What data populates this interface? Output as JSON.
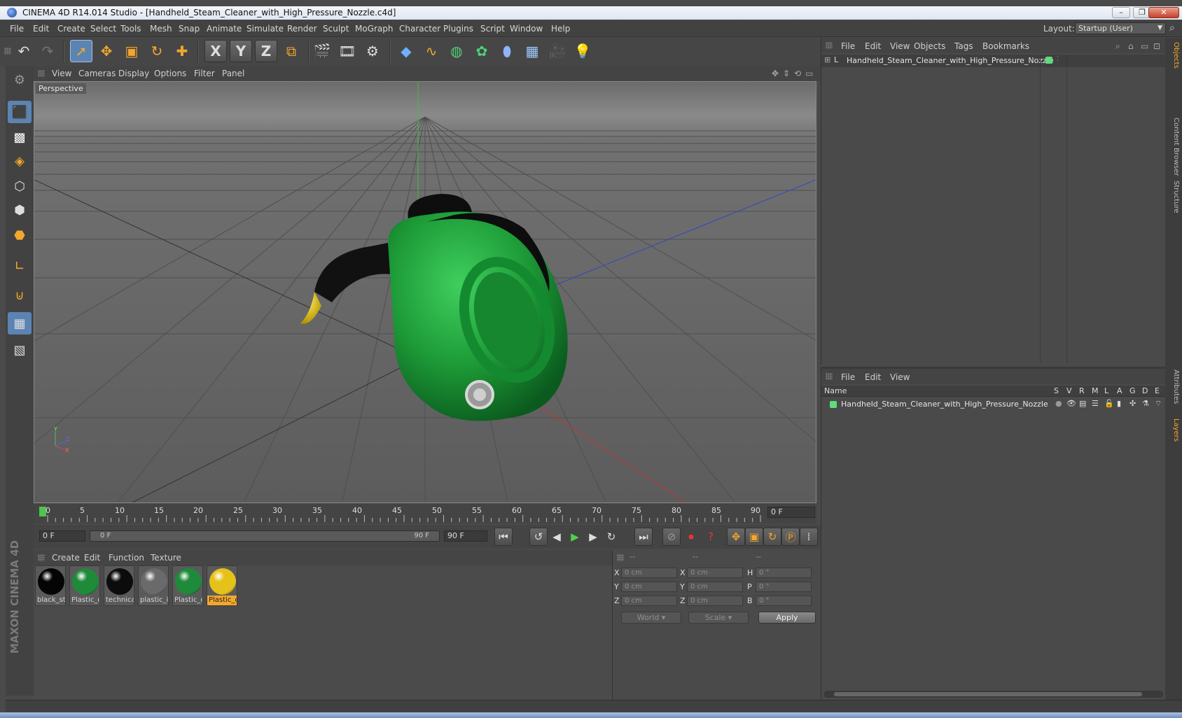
{
  "window": {
    "title": "CINEMA 4D R14.014 Studio - [Handheld_Steam_Cleaner_with_High_Pressure_Nozzle.c4d]",
    "controls": [
      "–",
      "❐",
      "✕"
    ]
  },
  "menubar": {
    "items": [
      "File",
      "Edit",
      "Create",
      "Select",
      "Tools",
      "Mesh",
      "Snap",
      "Animate",
      "Simulate",
      "Render",
      "Sculpt",
      "MoGraph",
      "Character",
      "Plugins",
      "Script",
      "Window",
      "Help"
    ],
    "layout_label": "Layout:",
    "layout_value": "Startup (User)"
  },
  "toolbar": {
    "icons": [
      "undo-icon",
      "redo-icon",
      "select-icon",
      "move-icon",
      "scale-icon",
      "rotate-icon",
      "add-icon",
      "x-axis-icon",
      "y-axis-icon",
      "z-axis-icon",
      "coordinate-system-icon",
      "render-view-icon",
      "render-picture-viewer-icon",
      "edit-render-settings-icon",
      "cube-icon",
      "spline-pen-icon",
      "nurbs-icon",
      "array-icon",
      "deformer-icon",
      "floor-icon",
      "camera-icon",
      "light-icon"
    ],
    "axis_labels": [
      "X",
      "Y",
      "Z"
    ]
  },
  "viewport": {
    "menu": [
      "View",
      "Cameras",
      "Display",
      "Options",
      "Filter",
      "Panel"
    ],
    "label": "Perspective",
    "axis_gizmo": {
      "y": "Y",
      "z": "Z",
      "x": "X"
    }
  },
  "timeline": {
    "ticks": [
      "0",
      "5",
      "10",
      "15",
      "20",
      "25",
      "30",
      "35",
      "40",
      "45",
      "50",
      "55",
      "60",
      "65",
      "70",
      "75",
      "80",
      "85",
      "90"
    ],
    "current_frame": "0 F",
    "start_frame": "0 F",
    "range_start": "0 F",
    "range_end": "90 F",
    "end_frame": "90 F"
  },
  "materials": {
    "menu": [
      "Create",
      "Edit",
      "Function",
      "Texture"
    ],
    "items": [
      {
        "label": "black_st",
        "color": "#050505",
        "selected": false
      },
      {
        "label": "Plastic_c",
        "color": "#1f8a3a",
        "selected": false
      },
      {
        "label": "technica",
        "color": "#0c0c0c",
        "selected": false
      },
      {
        "label": "plastic_i",
        "color": "#6a6a6a",
        "selected": false
      },
      {
        "label": "Plastic_c",
        "color": "#1f8a3a",
        "selected": false
      },
      {
        "label": "Plastic_c",
        "color": "#e5c21a",
        "selected": true
      }
    ]
  },
  "coordinates": {
    "headers": [
      "--",
      "--",
      "--"
    ],
    "rows": [
      {
        "pos_label": "X",
        "pos": "0 cm",
        "size_label": "X",
        "size": "0 cm",
        "rot_label": "H",
        "rot": "0 °"
      },
      {
        "pos_label": "Y",
        "pos": "0 cm",
        "size_label": "Y",
        "size": "0 cm",
        "rot_label": "P",
        "rot": "0 °"
      },
      {
        "pos_label": "Z",
        "pos": "0 cm",
        "size_label": "Z",
        "size": "0 cm",
        "rot_label": "B",
        "rot": "0 °"
      }
    ],
    "space": "World",
    "mode": "Scale",
    "apply": "Apply"
  },
  "object_manager": {
    "menu": [
      "File",
      "Edit",
      "View",
      "Objects",
      "Tags",
      "Bookmarks"
    ],
    "object_name": "Handheld_Steam_Cleaner_with_High_Pressure_Nozzle",
    "layer_color": "#5fdc7c"
  },
  "layer_manager": {
    "menu": [
      "File",
      "Edit",
      "View"
    ],
    "columns": [
      "Name",
      "S",
      "V",
      "R",
      "M",
      "L",
      "A",
      "G",
      "D",
      "E"
    ],
    "layer_name": "Handheld_Steam_Cleaner_with_High_Pressure_Nozzle"
  },
  "right_tabs": [
    "Objects",
    "Content Browser",
    "Structure",
    "Attributes",
    "Layers"
  ],
  "branding": "MAXON CINEMA 4D",
  "accent_color": "#f3a72c",
  "active_tool_color": "#5b84b3"
}
